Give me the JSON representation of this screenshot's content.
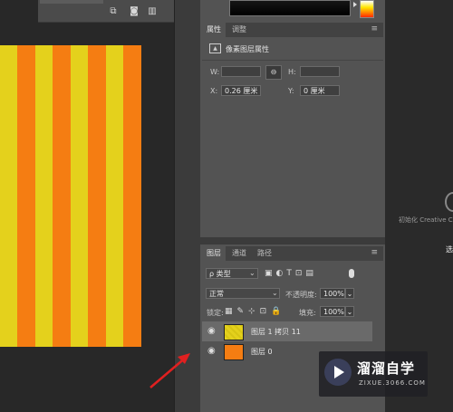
{
  "properties_panel": {
    "tabs": [
      "属性",
      "调整"
    ],
    "section_title": "像素图层属性",
    "w_label": "W:",
    "h_label": "H:",
    "x_label": "X:",
    "x_value": "0.26 厘米",
    "y_label": "Y:",
    "y_value": "0 厘米"
  },
  "layers_panel": {
    "tabs": [
      "图层",
      "通道",
      "路径"
    ],
    "filter_kind": "ρ 类型",
    "blend_mode": "正常",
    "opacity_label": "不透明度:",
    "opacity_value": "100%",
    "lock_label": "锁定:",
    "fill_label": "填充:",
    "fill_value": "100%",
    "layers": [
      {
        "name": "图层 1 拷贝 11",
        "selected": true
      },
      {
        "name": "图层 0",
        "selected": false
      }
    ]
  },
  "right_area": {
    "init_text": "初始化 Creative C",
    "cut_text": "选"
  },
  "watermark": {
    "brand": "溜溜自学",
    "url": "ZIXUE.3066.COM"
  },
  "colors": {
    "stripe_yellow": "#e4d11c",
    "stripe_orange": "#f57d12",
    "panel_bg": "#535353"
  }
}
